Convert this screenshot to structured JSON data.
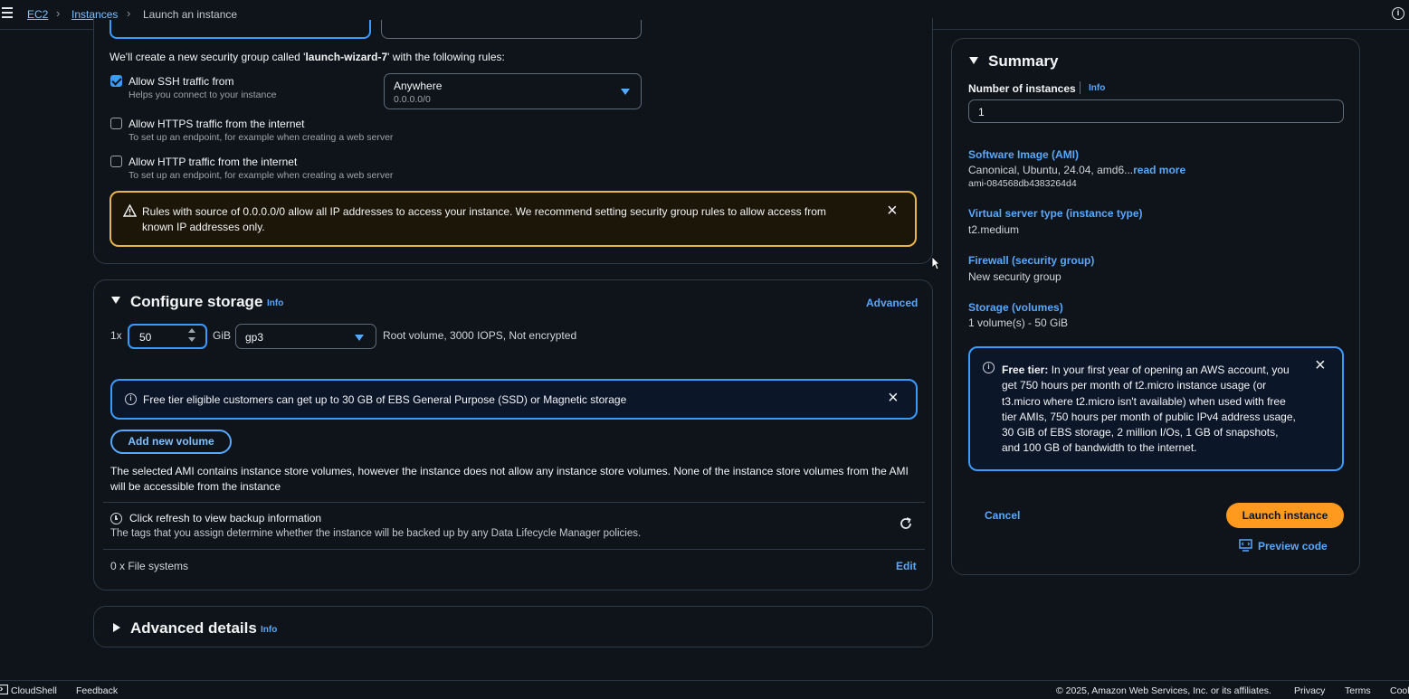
{
  "breadcrumb": {
    "root": "EC2",
    "instances": "Instances",
    "current": "Launch an instance"
  },
  "network": {
    "sg_notice_prefix": "We'll create a new security group called '",
    "sg_name": "launch-wizard-7",
    "sg_notice_suffix": "' with the following rules:",
    "rules": [
      {
        "label": "Allow SSH traffic from",
        "help": "Helps you connect to your instance",
        "checked": true
      },
      {
        "label": "Allow HTTPS traffic from the internet",
        "help": "To set up an endpoint, for example when creating a web server",
        "checked": false
      },
      {
        "label": "Allow HTTP traffic from the internet",
        "help": "To set up an endpoint, for example when creating a web server",
        "checked": false
      }
    ],
    "ssh_source": {
      "value": "Anywhere",
      "sub": "0.0.0.0/0"
    },
    "warning_text": "Rules with source of 0.0.0.0/0 allow all IP addresses to access your instance. We recommend setting security group rules to allow access from known IP addresses only."
  },
  "storage": {
    "title": "Configure storage",
    "info": "Info",
    "advanced": "Advanced",
    "count": "1x",
    "size": "50",
    "unit": "GiB",
    "volume_type": "gp3",
    "volume_desc": "Root volume,  3000 IOPS,  Not encrypted",
    "free_tier_note": "Free tier eligible customers can get up to 30 GB of EBS General Purpose (SSD) or Magnetic storage",
    "add_volume": "Add new volume",
    "instance_store_note": "The selected AMI contains instance store volumes, however the instance does not allow any instance store volumes. None of the instance store volumes from the AMI will be accessible from the instance",
    "backup_title": "Click refresh to view backup information",
    "backup_sub": "The tags that you assign determine whether the instance will be backed up by any Data Lifecycle Manager policies.",
    "file_systems": "0 x File systems",
    "edit": "Edit"
  },
  "advanced_details": {
    "title": "Advanced details",
    "info": "Info"
  },
  "summary": {
    "title": "Summary",
    "num_instances_label": "Number of instances",
    "info": "Info",
    "num_instances_value": "1",
    "ami_label": "Software Image (AMI)",
    "ami_value": "Canonical, Ubuntu, 24.04, amd6...",
    "ami_read_more": "read more",
    "ami_id": "ami-084568db4383264d4",
    "type_label": "Virtual server type (instance type)",
    "type_value": "t2.medium",
    "firewall_label": "Firewall (security group)",
    "firewall_value": "New security group",
    "storage_label": "Storage (volumes)",
    "storage_value": "1 volume(s) - 50 GiB",
    "free_tier_bold": "Free tier:",
    "free_tier_text": " In your first year of opening an AWS account, you get 750 hours per month of t2.micro instance usage (or t3.micro where t2.micro isn't available) when used with free tier AMIs, 750 hours per month of public IPv4 address usage, 30 GiB of EBS storage, 2 million I/Os, 1 GB of snapshots, and 100 GB of bandwidth to the internet.",
    "cancel": "Cancel",
    "launch": "Launch instance",
    "preview": "Preview code"
  },
  "footer": {
    "cloudshell": "CloudShell",
    "feedback": "Feedback",
    "copyright": "© 2025, Amazon Web Services, Inc. or its affiliates.",
    "privacy": "Privacy",
    "terms": "Terms",
    "cookie": "Cookie preferences"
  }
}
